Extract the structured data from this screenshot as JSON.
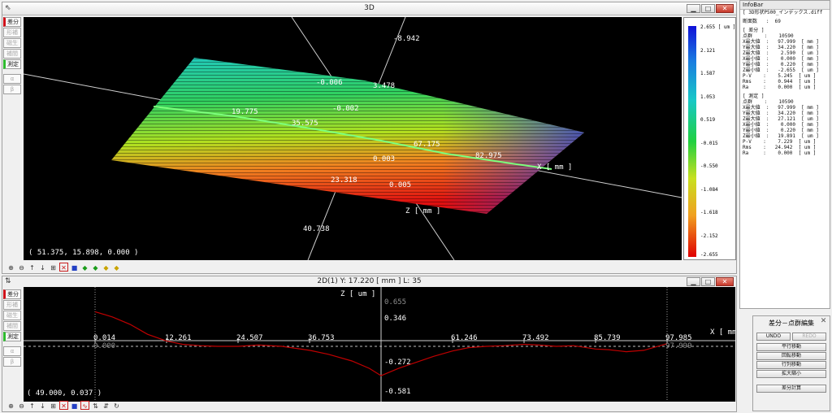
{
  "view3d": {
    "title": "3D",
    "tools": [
      "差分",
      "形補",
      "磁生",
      "補間",
      "測定",
      "α",
      "β"
    ],
    "axis_labels": [
      {
        "id": "top",
        "text": "-8.942"
      },
      {
        "id": "a1",
        "text": "-0.006"
      },
      {
        "id": "a2",
        "text": "3.478"
      },
      {
        "id": "a3",
        "text": "19.775"
      },
      {
        "id": "a4",
        "text": "-0.002"
      },
      {
        "id": "a5",
        "text": "35.575"
      },
      {
        "id": "a6",
        "text": "67.175"
      },
      {
        "id": "a7",
        "text": "82.975"
      },
      {
        "id": "a8",
        "text": "0.003"
      },
      {
        "id": "a9",
        "text": "23.318"
      },
      {
        "id": "a10",
        "text": "0.005"
      },
      {
        "id": "a11",
        "text": "40.738"
      }
    ],
    "x_axis_name": "X [ mm ]",
    "z_axis_name": "Z [ mm ]",
    "coordinate_readout": "( 51.375, 15.898, 0.000 )",
    "legend": {
      "unit": "2.655 [ um ]",
      "ticks": [
        "2.121",
        "1.587",
        "1.053",
        "0.519",
        "-0.015",
        "-0.550",
        "-1.084",
        "-1.618",
        "-2.152",
        "-2.655"
      ]
    }
  },
  "view2d": {
    "title": "2D(1)   Y: 17.220 [ mm ]   L: 35",
    "tools": [
      "差分",
      "形補",
      "磁生",
      "補間",
      "測定",
      "α",
      "β"
    ],
    "z_axis_name": "Z [ um ]",
    "x_axis_name": "X [ mm",
    "y_labels": {
      "top_grey": "0.655",
      "top": "0.346",
      "neg": "-0.272",
      "bottom": "-0.581",
      "zero_left": "0.000",
      "zero_right": "97.999"
    },
    "x_ticks": [
      "0.014",
      "12.261",
      "24.507",
      "36.753",
      "61.246",
      "73.492",
      "85.739",
      "97.985"
    ],
    "coordinate_readout": "( 49.000, 0.037 )",
    "chart_data": {
      "type": "line",
      "xlabel": "X [ mm ]",
      "ylabel": "Z [ um ]",
      "xlim": [
        0.014,
        97.985
      ],
      "ylim": [
        -0.581,
        0.655
      ],
      "series": [
        {
          "name": "",
          "x": [
            0.014,
            3,
            6,
            9,
            12.261,
            15,
            18,
            21,
            24.507,
            28,
            32,
            36.753,
            40,
            44,
            47,
            49,
            52,
            55,
            58,
            61.246,
            64,
            67,
            70,
            73.492,
            76,
            79,
            82,
            85.739,
            88,
            91,
            94,
            97.985
          ],
          "values": [
            0.52,
            0.44,
            0.33,
            0.18,
            0.08,
            0.03,
            0.01,
            0.0,
            0.0,
            0.02,
            0.0,
            -0.06,
            -0.12,
            -0.22,
            -0.33,
            -0.44,
            -0.33,
            -0.24,
            -0.15,
            -0.07,
            -0.02,
            0.0,
            0.01,
            0.03,
            0.02,
            0.0,
            0.01,
            -0.04,
            -0.05,
            -0.08,
            -0.06,
            0.04
          ]
        }
      ]
    }
  },
  "infobar": {
    "title": "InfoBar",
    "file": "[ 3D形状P500_インデックス.diff",
    "section_count_label": "断面数   :  69",
    "diff_header": "[ 差分 ]",
    "diff_lines": [
      "点群    :    10590",
      "X最大値  :   97.999  [ mm ]",
      "Y最大値  :   34.220  [ mm ]",
      "Z最大値  :    2.590  [ um ]",
      "X最小値  :    0.000  [ mm ]",
      "Y最小値  :    0.220  [ mm ]",
      "Z最小値  :   -2.655  [ um ]",
      "P-V    :    5.245  [ um ]",
      "Rms    :    0.944  [ um ]",
      "Ra     :    0.000  [ um ]"
    ],
    "measure_header": "[ 測定 ]",
    "measure_lines": [
      "点群    :    10590",
      "X最大値  :   97.999  [ mm ]",
      "Y最大値  :   34.220  [ mm ]",
      "Z最大値  :   27.121  [ um ]",
      "X最小値  :    0.000  [ mm ]",
      "Y最小値  :    0.220  [ mm ]",
      "Z最小値  :   19.891  [ um ]",
      "P-V    :    7.229  [ um ]",
      "Rms    :   24.942  [ um ]",
      "Ra     :    0.000  [ um ]"
    ]
  },
  "diffpanel": {
    "title": "差分－点群編集",
    "undo": "UNDO",
    "redo": "REDO",
    "buttons": [
      "平行移動",
      "回転移動",
      "行列移動",
      "拡大縮小"
    ],
    "calc": "差分計算"
  },
  "colors": {
    "profile_line": "#c00000",
    "axis": "#cfcfcf"
  }
}
